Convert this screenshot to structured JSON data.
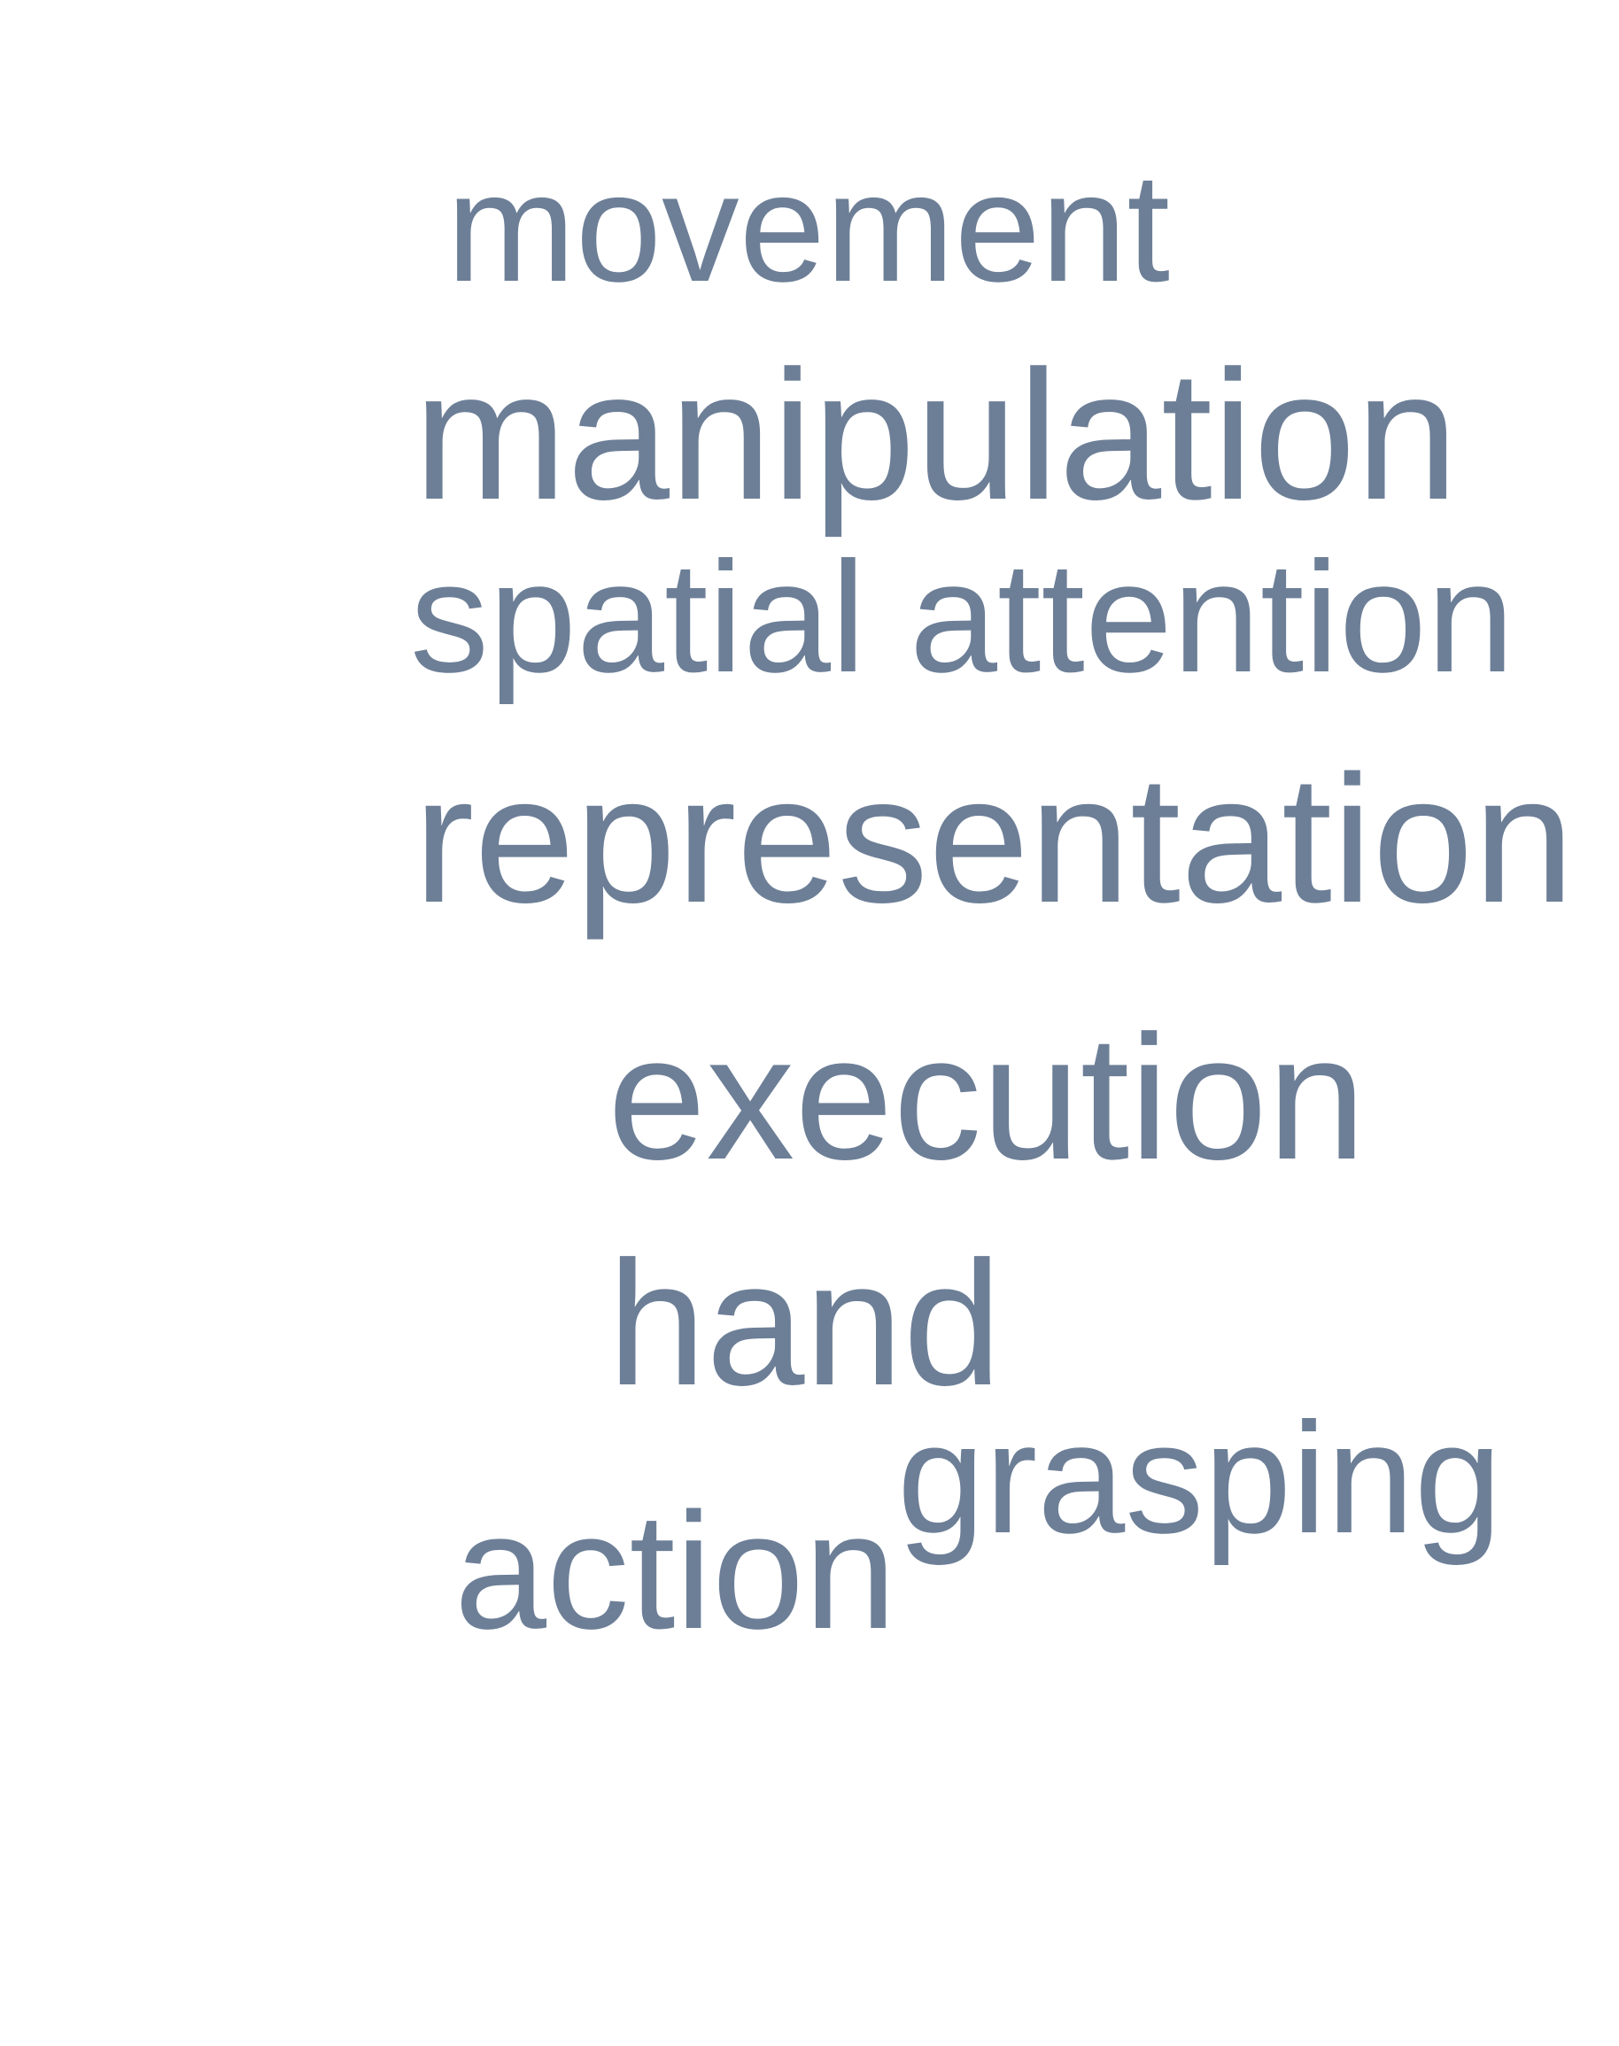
{
  "word_cloud": {
    "color": "#6d7f97",
    "words": [
      {
        "key": "movement",
        "text": "movement"
      },
      {
        "key": "manipulation",
        "text": "manipulation"
      },
      {
        "key": "spatial",
        "text": "spatial attention"
      },
      {
        "key": "representation",
        "text": "representation"
      },
      {
        "key": "execution",
        "text": "execution"
      },
      {
        "key": "hand",
        "text": "hand"
      },
      {
        "key": "grasping",
        "text": "grasping"
      },
      {
        "key": "action",
        "text": "action"
      }
    ]
  }
}
